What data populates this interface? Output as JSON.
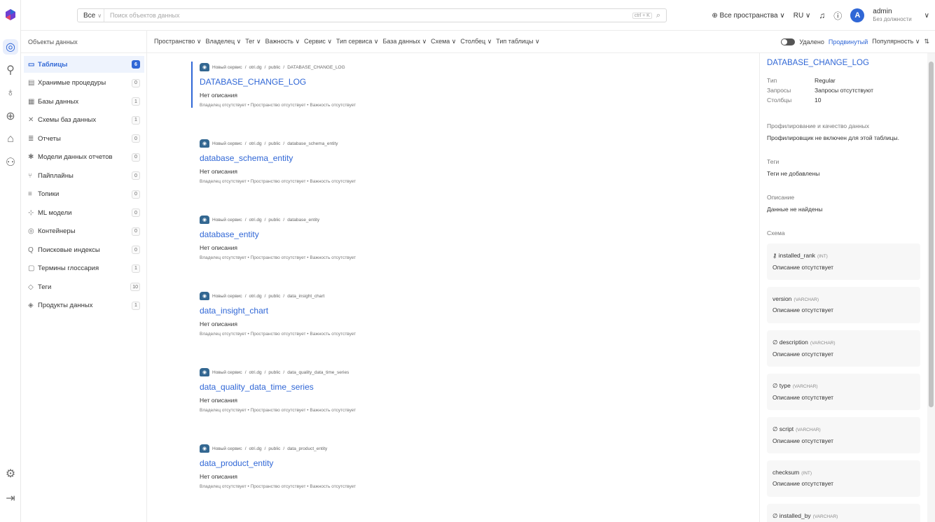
{
  "header": {
    "search_scope": "Все",
    "search_placeholder": "Поиск объектов данных",
    "kbd_hint": "ctrl + K",
    "spaces": "Все пространства",
    "language": "RU",
    "user_initial": "A",
    "user_name": "admin",
    "user_role": "Без должности"
  },
  "nav": {
    "title": "Объекты данных",
    "items": [
      {
        "label": "Таблицы",
        "count": "6",
        "icon": "table-icon"
      },
      {
        "label": "Хранимые процедуры",
        "count": "0",
        "icon": "procedure-icon"
      },
      {
        "label": "Базы данных",
        "count": "1",
        "icon": "database-icon"
      },
      {
        "label": "Схемы баз данных",
        "count": "1",
        "icon": "schema-icon"
      },
      {
        "label": "Отчеты",
        "count": "0",
        "icon": "report-icon"
      },
      {
        "label": "Модели данных отчетов",
        "count": "0",
        "icon": "model-icon"
      },
      {
        "label": "Пайплайны",
        "count": "0",
        "icon": "pipeline-icon"
      },
      {
        "label": "Топики",
        "count": "0",
        "icon": "topic-icon"
      },
      {
        "label": "ML модели",
        "count": "0",
        "icon": "ml-icon"
      },
      {
        "label": "Контейнеры",
        "count": "0",
        "icon": "container-icon"
      },
      {
        "label": "Поисковые индексы",
        "count": "0",
        "icon": "search-index-icon"
      },
      {
        "label": "Термины глоссария",
        "count": "1",
        "icon": "glossary-icon"
      },
      {
        "label": "Теги",
        "count": "10",
        "icon": "tag-icon"
      },
      {
        "label": "Продукты данных",
        "count": "1",
        "icon": "data-product-icon"
      }
    ]
  },
  "filters": {
    "items": [
      "Пространство",
      "Владелец",
      "Тег",
      "Важность",
      "Сервис",
      "Тип сервиса",
      "База данных",
      "Схема",
      "Столбец",
      "Тип таблицы"
    ],
    "deleted": "Удалено",
    "advanced": "Продвинутый",
    "sort": "Популярность"
  },
  "results": [
    {
      "service": "Новый сервис",
      "db": "otri.dg",
      "schema": "public",
      "table": "DATABASE_CHANGE_LOG",
      "name": "DATABASE_CHANGE_LOG",
      "desc": "Нет описания",
      "meta": "Владелец отсутствует • Пространство отсутствует • Важность отсутствует"
    },
    {
      "service": "Новый сервис",
      "db": "otri.dg",
      "schema": "public",
      "table": "database_schema_entity",
      "name": "database_schema_entity",
      "desc": "Нет описания",
      "meta": "Владелец отсутствует • Пространство отсутствует • Важность отсутствует"
    },
    {
      "service": "Новый сервис",
      "db": "otri.dg",
      "schema": "public",
      "table": "database_entity",
      "name": "database_entity",
      "desc": "Нет описания",
      "meta": "Владелец отсутствует • Пространство отсутствует • Важность отсутствует"
    },
    {
      "service": "Новый сервис",
      "db": "otri.dg",
      "schema": "public",
      "table": "data_insight_chart",
      "name": "data_insight_chart",
      "desc": "Нет описания",
      "meta": "Владелец отсутствует • Пространство отсутствует • Важность отсутствует"
    },
    {
      "service": "Новый сервис",
      "db": "otri.dg",
      "schema": "public",
      "table": "data_quality_data_time_series",
      "name": "data_quality_data_time_series",
      "desc": "Нет описания",
      "meta": "Владелец отсутствует • Пространство отсутствует • Важность отсутствует"
    },
    {
      "service": "Новый сервис",
      "db": "otri.dg",
      "schema": "public",
      "table": "data_product_entity",
      "name": "data_product_entity",
      "desc": "Нет описания",
      "meta": "Владелец отсутствует • Пространство отсутствует • Важность отсутствует"
    }
  ],
  "details": {
    "title": "DATABASE_CHANGE_LOG",
    "type_label": "Тип",
    "type_value": "Regular",
    "queries_label": "Запросы",
    "queries_value": "Запросы отсутствуют",
    "columns_label": "Столбцы",
    "columns_value": "10",
    "profiling_label": "Профилирование и качество данных",
    "profiling_value": "Профилировщик не включен для этой таблицы.",
    "tags_label": "Теги",
    "tags_value": "Теги не добавлены",
    "description_label": "Описание",
    "description_value": "Данные не найдены",
    "schema_label": "Схема",
    "columns": [
      {
        "name": "installed_rank",
        "type": "(INT)",
        "desc": "Описание отсутствует",
        "icon": "key-icon"
      },
      {
        "name": "version",
        "type": "(VARCHAR)",
        "desc": "Описание отсутствует",
        "icon": ""
      },
      {
        "name": "description",
        "type": "(VARCHAR)",
        "desc": "Описание отсутствует",
        "icon": "null-icon"
      },
      {
        "name": "type",
        "type": "(VARCHAR)",
        "desc": "Описание отсутствует",
        "icon": "null-icon"
      },
      {
        "name": "script",
        "type": "(VARCHAR)",
        "desc": "Описание отсутствует",
        "icon": "null-icon"
      },
      {
        "name": "checksum",
        "type": "(INT)",
        "desc": "Описание отсутствует",
        "icon": ""
      },
      {
        "name": "installed_by",
        "type": "(VARCHAR)",
        "desc": "",
        "icon": "null-icon"
      }
    ]
  }
}
